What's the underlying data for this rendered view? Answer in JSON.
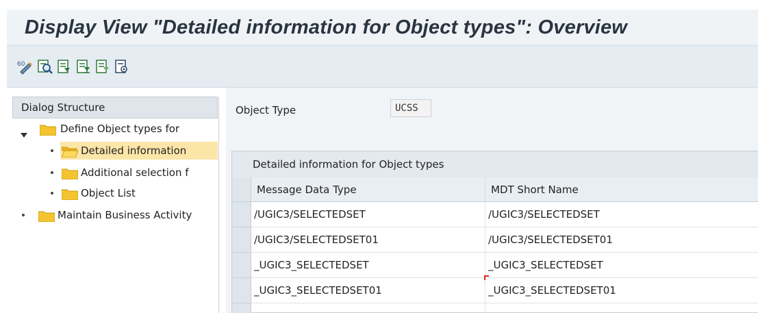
{
  "title": "Display View \"Detailed information for Object types\": Overview",
  "toolbar": {
    "buttons": [
      {
        "name": "display-change-icon"
      },
      {
        "name": "find-icon"
      },
      {
        "name": "first-page-icon"
      },
      {
        "name": "previous-page-icon"
      },
      {
        "name": "next-page-icon"
      },
      {
        "name": "details-icon"
      }
    ]
  },
  "dialog_structure": {
    "header": "Dialog Structure",
    "items": [
      {
        "label": "Define Object types for",
        "level": 0,
        "expanded": true,
        "selected": false
      },
      {
        "label": "Detailed information",
        "level": 1,
        "selected": true
      },
      {
        "label": "Additional selection f",
        "level": 1,
        "selected": false
      },
      {
        "label": "Object List",
        "level": 1,
        "selected": false
      },
      {
        "label": "Maintain Business Activity",
        "level": 0,
        "selected": false
      }
    ]
  },
  "object_type": {
    "label": "Object Type",
    "value": "UCSS"
  },
  "table": {
    "caption": "Detailed information for Object types",
    "columns": [
      "Message Data Type",
      "MDT Short Name"
    ],
    "rows": [
      [
        "/UGIC3/SELECTEDSET",
        "/UGIC3/SELECTEDSET"
      ],
      [
        "/UGIC3/SELECTEDSET01",
        "/UGIC3/SELECTEDSET01"
      ],
      [
        "_UGIC3_SELECTEDSET",
        "_UGIC3_SELECTEDSET"
      ],
      [
        "_UGIC3_SELECTEDSET01",
        "_UGIC3_SELECTEDSET01"
      ],
      [
        "",
        ""
      ]
    ]
  },
  "colors": {
    "folder": "#f4c430",
    "selected_row": "#fbe6a8",
    "title_text": "#2a3440"
  }
}
